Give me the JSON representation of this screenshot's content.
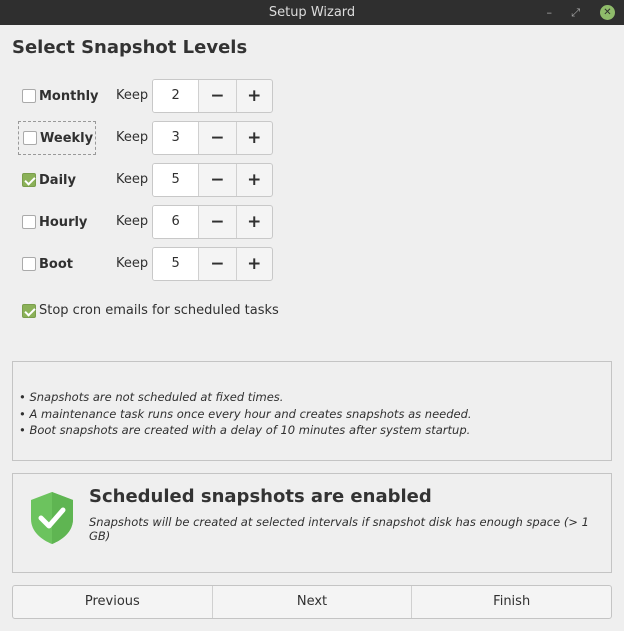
{
  "window": {
    "title": "Setup Wizard",
    "minimize": "–",
    "maximize": "⤢",
    "close": "✕"
  },
  "heading": "Select Snapshot Levels",
  "keep_label": "Keep",
  "levels": [
    {
      "label": "Monthly",
      "checked": false,
      "keep": "2"
    },
    {
      "label": "Weekly",
      "checked": false,
      "keep": "3"
    },
    {
      "label": "Daily",
      "checked": true,
      "keep": "5"
    },
    {
      "label": "Hourly",
      "checked": false,
      "keep": "6"
    },
    {
      "label": "Boot",
      "checked": false,
      "keep": "5"
    }
  ],
  "spin": {
    "minus": "−",
    "plus": "+"
  },
  "cron": {
    "label": "Stop cron emails for scheduled tasks",
    "checked": true
  },
  "info": [
    "• Snapshots are not scheduled at fixed times.",
    "• A maintenance task runs once every hour and creates snapshots as needed.",
    "• Boot snapshots are created with a delay of 10 minutes after system startup."
  ],
  "status": {
    "title": "Scheduled snapshots are enabled",
    "subtitle": "Snapshots will be created at selected intervals if snapshot disk has enough space (> 1 GB)",
    "color": "#6cc35e"
  },
  "nav": {
    "previous": "Previous",
    "next": "Next",
    "finish": "Finish"
  }
}
